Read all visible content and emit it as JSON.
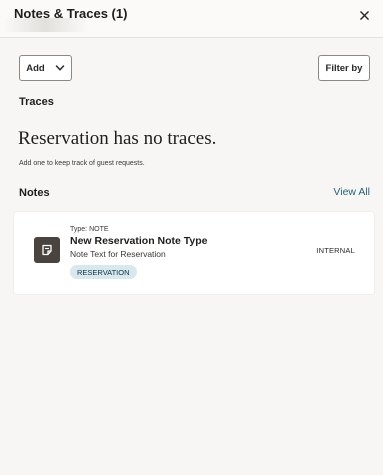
{
  "header": {
    "title": "Notes & Traces (1)",
    "close_icon": "close-icon"
  },
  "toolbar": {
    "add_label": "Add",
    "add_icon": "chevron-down-icon",
    "filter_label": "Filter by"
  },
  "traces": {
    "heading": "Traces",
    "empty_title": "Reservation has no traces.",
    "empty_subtitle": "Add one to keep track of guest requests."
  },
  "notes": {
    "heading": "Notes",
    "view_all_label": "View All",
    "items": [
      {
        "icon": "note-icon",
        "type_label": "Type: NOTE",
        "title": "New Reservation Note Type",
        "text": "Note Text for Reservation",
        "badge": "RESERVATION",
        "visibility": "INTERNAL"
      }
    ]
  },
  "colors": {
    "background": "#f7f6f4",
    "card": "#ffffff",
    "link": "#27617a",
    "badge_bg": "#d7e8ee",
    "icon_bg": "#4a4440"
  }
}
